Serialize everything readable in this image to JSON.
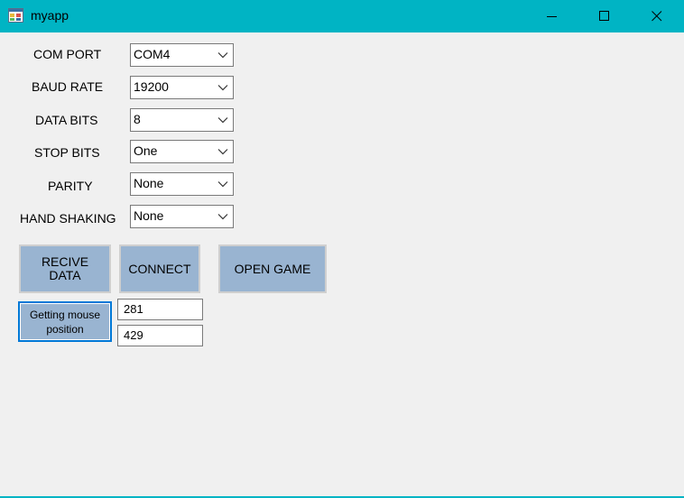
{
  "window": {
    "title": "myapp",
    "icon": "app-window-icon",
    "titlebar_color": "#00b4c4",
    "controls": [
      "minimize-icon",
      "maximize-icon",
      "close-icon"
    ]
  },
  "settings": {
    "com_port": {
      "label": "COM PORT",
      "value": "COM4"
    },
    "baud_rate": {
      "label": "BAUD RATE",
      "value": "19200"
    },
    "data_bits": {
      "label": "DATA BITS",
      "value": "8"
    },
    "stop_bits": {
      "label": "STOP BITS",
      "value": "One"
    },
    "parity": {
      "label": "PARITY",
      "value": "None"
    },
    "hand_shaking": {
      "label": "HAND SHAKING",
      "value": "None"
    }
  },
  "buttons": {
    "receive_data_line1": "RECIVE",
    "receive_data_line2": "DATA",
    "connect": "CONNECT",
    "open_game": "OPEN GAME",
    "mouse_position_line1": "Getting mouse",
    "mouse_position_line2": "position"
  },
  "mouse_position": {
    "x": "281",
    "y": "429"
  },
  "colors": {
    "button_bg": "#99b4d1",
    "focus_border": "#0078d7"
  }
}
